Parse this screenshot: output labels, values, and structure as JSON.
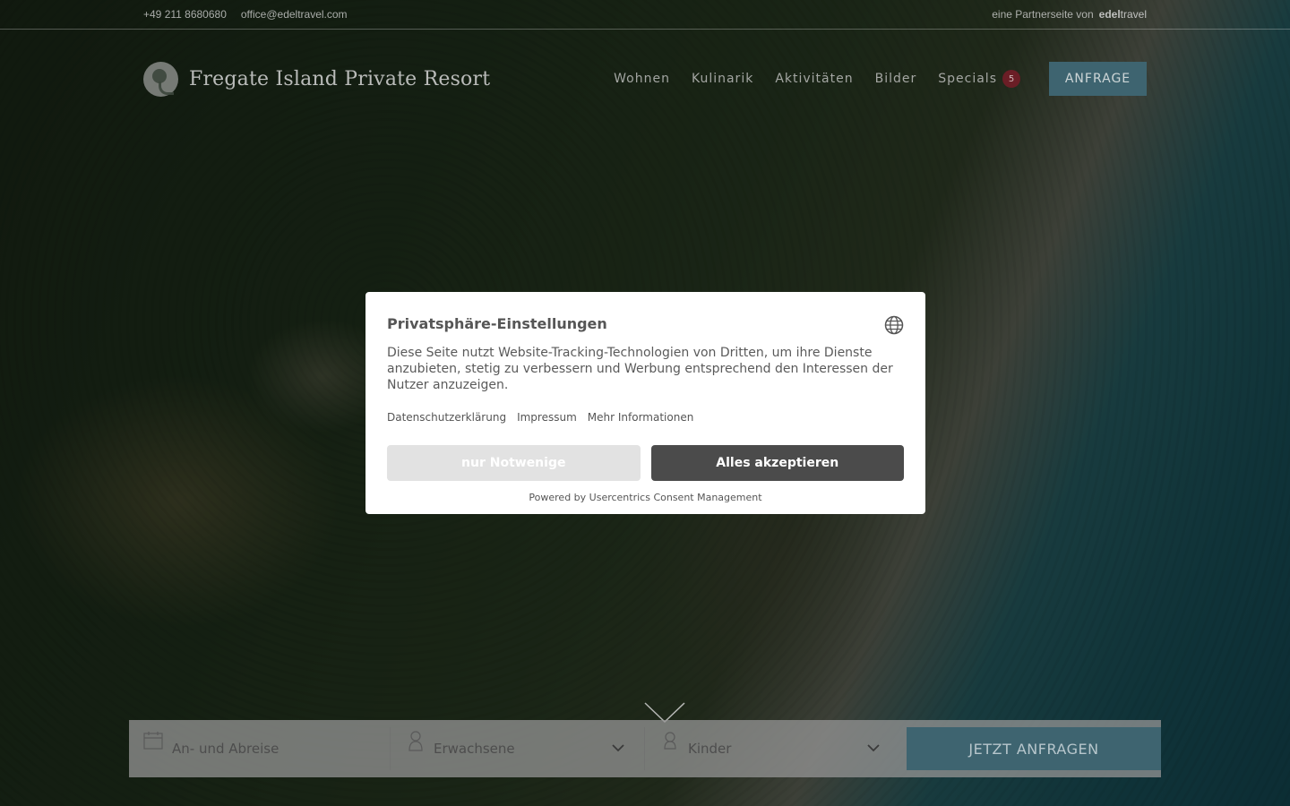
{
  "topbar": {
    "phone": "+49 211 8680680",
    "email": "office@edeltravel.com",
    "partner_text": "eine Partnerseite von",
    "partner_logo_bold": "edel",
    "partner_logo_rest": "travel"
  },
  "header": {
    "logo_text": "Fregate Island Private Resort",
    "nav": [
      {
        "label": "Wohnen"
      },
      {
        "label": "Kulinarik"
      },
      {
        "label": "Aktivitäten"
      },
      {
        "label": "Bilder"
      },
      {
        "label": "Specials",
        "badge": "5"
      }
    ],
    "cta_label": "ANFRAGE"
  },
  "booking": {
    "dates_placeholder": "An- und Abreise",
    "adults_label": "Erwachsene",
    "kids_label": "Kinder",
    "submit_label": "JETZT ANFRAGEN"
  },
  "consent": {
    "title": "Privatsphäre-Einstellungen",
    "body": "Diese Seite nutzt Website-Tracking-Technologien von Dritten, um ihre Dienste anzubieten, stetig zu verbessern und Werbung entsprechend den Interessen der Nutzer anzuzeigen.",
    "links": [
      "Datenschutzerklärung",
      "Impressum",
      "Mehr Informationen"
    ],
    "deny_label": "nur Notwenige",
    "accept_label": "Alles akzeptieren",
    "powered_by": "Powered by Usercentrics Consent Management"
  },
  "colors": {
    "accent_teal": "#3e6470",
    "badge_red": "#6b1e26",
    "accept_button": "#4b4b4b",
    "deny_button": "#e2e2e2"
  }
}
